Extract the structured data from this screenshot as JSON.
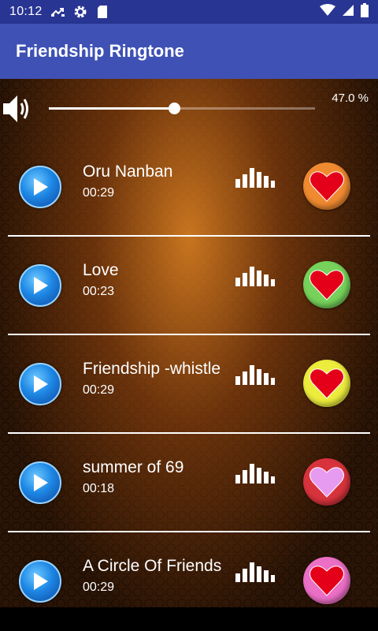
{
  "status_bar": {
    "time": "10:12",
    "icons": [
      "call-forward-icon",
      "settings-icon",
      "sd-card-icon",
      "wifi-icon",
      "signal-icon",
      "battery-icon"
    ]
  },
  "app_bar": {
    "title": "Friendship Ringtone",
    "color": "#3f51b5"
  },
  "volume": {
    "label": "47.0 %",
    "level": 0.47
  },
  "songs": [
    {
      "title": "Oru Nanban",
      "duration": "00:29",
      "heart_bg": "#f08a30",
      "heart_color": "#e5001a"
    },
    {
      "title": "Love",
      "duration": "00:23",
      "heart_bg": "#76d25a",
      "heart_color": "#e5001a"
    },
    {
      "title": "Friendship -whistle",
      "duration": "00:29",
      "heart_bg": "#ecec3c",
      "heart_color": "#e5001a"
    },
    {
      "title": "summer of 69",
      "duration": "00:18",
      "heart_bg": "#d8333c",
      "heart_color": "#e79bf0"
    },
    {
      "title": "A Circle Of Friends",
      "duration": "00:29",
      "heart_bg": "#ec6fc6",
      "heart_color": "#e5001a"
    }
  ]
}
